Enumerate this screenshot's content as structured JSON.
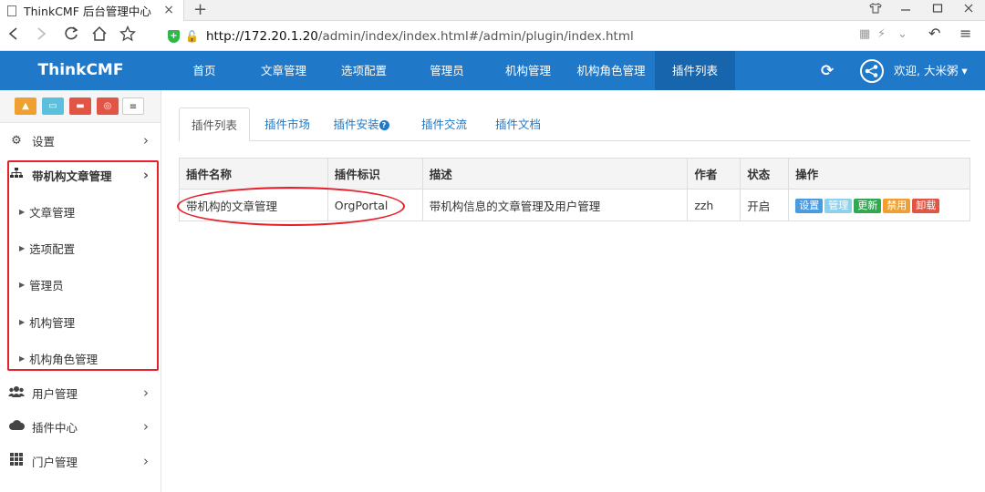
{
  "browser": {
    "tab_title": "ThinkCMF 后台管理中心",
    "tab_close": "×",
    "new_tab": "+",
    "url_host": "http://172.20.1.20",
    "url_path": "/admin/index/index.html#/admin/plugin/index.html"
  },
  "header": {
    "brand": "ThinkCMF",
    "nav": [
      "首页",
      "文章管理",
      "选项配置",
      "管理员",
      "机构管理",
      "机构角色管理",
      "插件列表"
    ],
    "active_nav": "插件列表",
    "welcome": "欢迎, 大米粥 ▾"
  },
  "sidebar": {
    "settings": "设置",
    "org_article": "带机构文章管理",
    "sub_items": [
      "文章管理",
      "选项配置",
      "管理员",
      "机构管理",
      "机构角色管理"
    ],
    "user_manage": "用户管理",
    "plugin_center": "插件中心",
    "portal_manage": "门户管理"
  },
  "tabs": [
    "插件列表",
    "插件市场",
    "插件安装",
    "插件交流",
    "插件文档"
  ],
  "table": {
    "headers": [
      "插件名称",
      "插件标识",
      "描述",
      "作者",
      "状态",
      "操作"
    ],
    "rows": [
      {
        "name": "带机构的文章管理",
        "id": "OrgPortal",
        "desc": "带机构信息的文章管理及用户管理",
        "author": "zzh",
        "status": "开启"
      }
    ],
    "actions": [
      "设置",
      "管理",
      "更新",
      "禁用",
      "卸载"
    ]
  },
  "colors": {
    "header_bg": "#1f78c8",
    "highlight": "#e8202a",
    "btn_settings": "#4a9be0",
    "btn_manage": "#8fd0ea",
    "btn_update": "#33a852",
    "btn_disable": "#f0a030",
    "btn_uninstall": "#e25544"
  }
}
